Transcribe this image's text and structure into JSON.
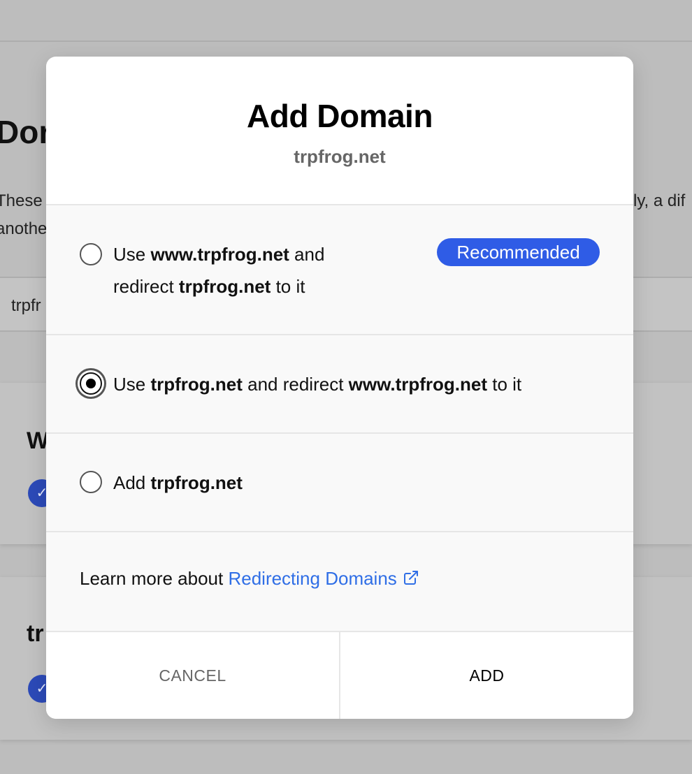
{
  "background": {
    "title_fragment": "Dor",
    "description_line1_fragment": "These",
    "description_line1_right_fragment": "ly, a dif",
    "description_line2_fragment": "anothe",
    "input_fragment": "trpfr",
    "cards": [
      {
        "title_fragment": "W"
      },
      {
        "title_fragment": "tr"
      }
    ]
  },
  "modal": {
    "title": "Add Domain",
    "subtitle": "trpfrog.net",
    "options": [
      {
        "line1_prefix": "Use ",
        "line1_domain": "www.trpfrog.net",
        "line1_suffix": " and",
        "line2_prefix": "redirect ",
        "line2_domain": "trpfrog.net",
        "line2_suffix": " to it",
        "badge": "Recommended",
        "selected": false
      },
      {
        "prefix": "Use ",
        "domain": "trpfrog.net",
        "middle": " and redirect ",
        "redirect_domain": "www.trpfrog.net",
        "suffix": " to it",
        "selected": true
      },
      {
        "prefix": "Add ",
        "domain": "trpfrog.net",
        "selected": false
      }
    ],
    "learn_more": {
      "prefix": "Learn more about ",
      "link_text": "Redirecting Domains",
      "icon": "external-link-icon"
    },
    "footer": {
      "cancel_label": "CANCEL",
      "add_label": "ADD"
    }
  },
  "colors": {
    "overlay": "#bdbdbd",
    "accent_blue": "#2f5ce6",
    "link_blue": "#2f6ee6",
    "subtitle_gray": "#666666"
  }
}
